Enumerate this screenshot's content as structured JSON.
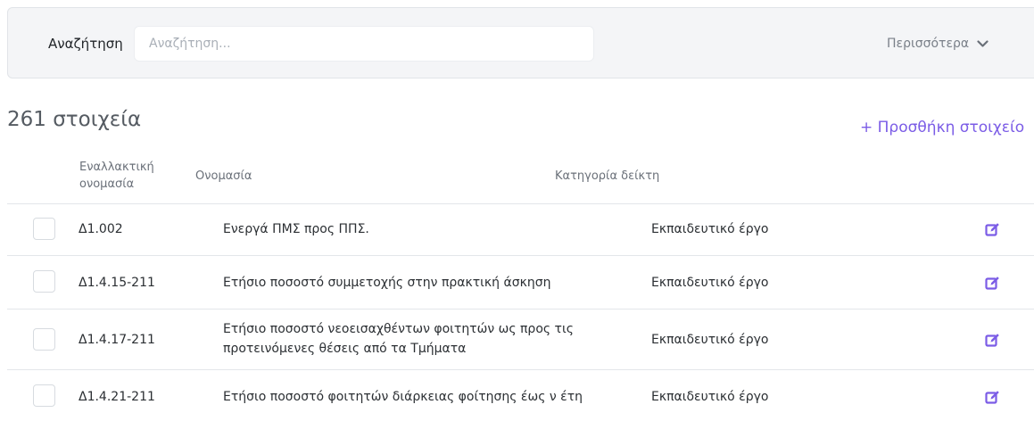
{
  "search": {
    "label": "Αναζήτηση",
    "placeholder": "Αναζήτηση...",
    "value": "",
    "more_label": "Περισσότερα"
  },
  "summary": {
    "count_text": "261 στοιχεία",
    "add_label": "+ Προσθήκη στοιχείο"
  },
  "table": {
    "headers": {
      "alt_name": "Εναλλακτική ονομασία",
      "name": "Ονομασία",
      "category": "Κατηγορία δείκτη"
    },
    "rows": [
      {
        "code": "Δ1.002",
        "name": "Ενεργά ΠΜΣ προς ΠΠΣ.",
        "category": "Εκπαιδευτικό έργο"
      },
      {
        "code": "Δ1.4.15-211",
        "name": "Ετήσιο ποσοστό συμμετοχής στην πρακτική άσκηση",
        "category": "Εκπαιδευτικό έργο"
      },
      {
        "code": "Δ1.4.17-211",
        "name": "Ετήσιο ποσοστό νεοεισαχθέντων φοιτητών ως προς τις προτεινόμενες θέσεις από τα Τμήματα",
        "category": "Εκπαιδευτικό έργο"
      },
      {
        "code": "Δ1.4.21-211",
        "name": "Ετήσιο ποσοστό φοιτητών διάρκειας φοίτησης έως ν έτη",
        "category": "Εκπαιδευτικό έργο"
      }
    ]
  },
  "icons": {
    "more": "chevron-down-icon",
    "edit": "edit-icon"
  },
  "colors": {
    "accent": "#7b5ce6",
    "panel_bg": "#f4f5f7"
  }
}
